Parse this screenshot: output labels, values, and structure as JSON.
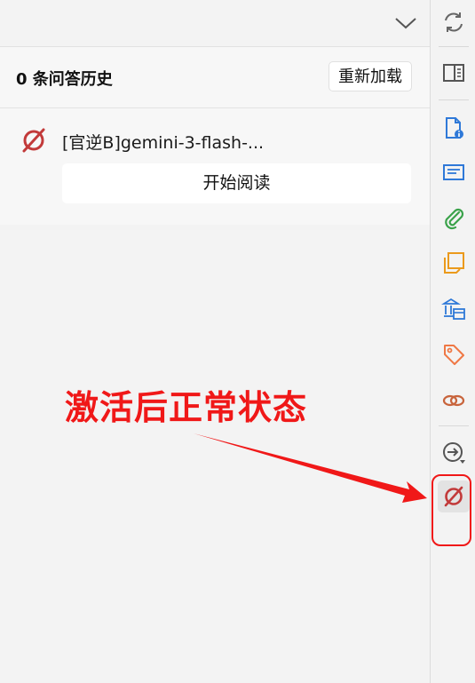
{
  "panel": {
    "title": "0 条问答历史",
    "reload_label": "重新加载"
  },
  "history": [
    {
      "title": "[官逆B]gemini-3-flash-...",
      "action_label": "开始阅读",
      "icon": "null-set-icon"
    }
  ],
  "sidebar": {
    "items": [
      {
        "name": "sync-icon"
      },
      {
        "name": "reader-view-icon"
      },
      {
        "name": "document-info-icon"
      },
      {
        "name": "abstract-icon"
      },
      {
        "name": "attachment-icon"
      },
      {
        "name": "notes-icon"
      },
      {
        "name": "library-collection-icon"
      },
      {
        "name": "tag-icon"
      },
      {
        "name": "related-link-icon"
      },
      {
        "name": "locate-icon"
      },
      {
        "name": "ai-plugin-icon",
        "active": true
      }
    ]
  },
  "annotation": {
    "text": "激活后正常状态"
  },
  "colors": {
    "annotation_red": "#f01818",
    "icon_blue": "#2f79d8",
    "icon_green": "#3aa24a",
    "icon_orange": "#eb9a1c",
    "icon_tag": "#ef7845",
    "icon_link": "#c8643c",
    "plugin_red": "#c23a3a"
  }
}
